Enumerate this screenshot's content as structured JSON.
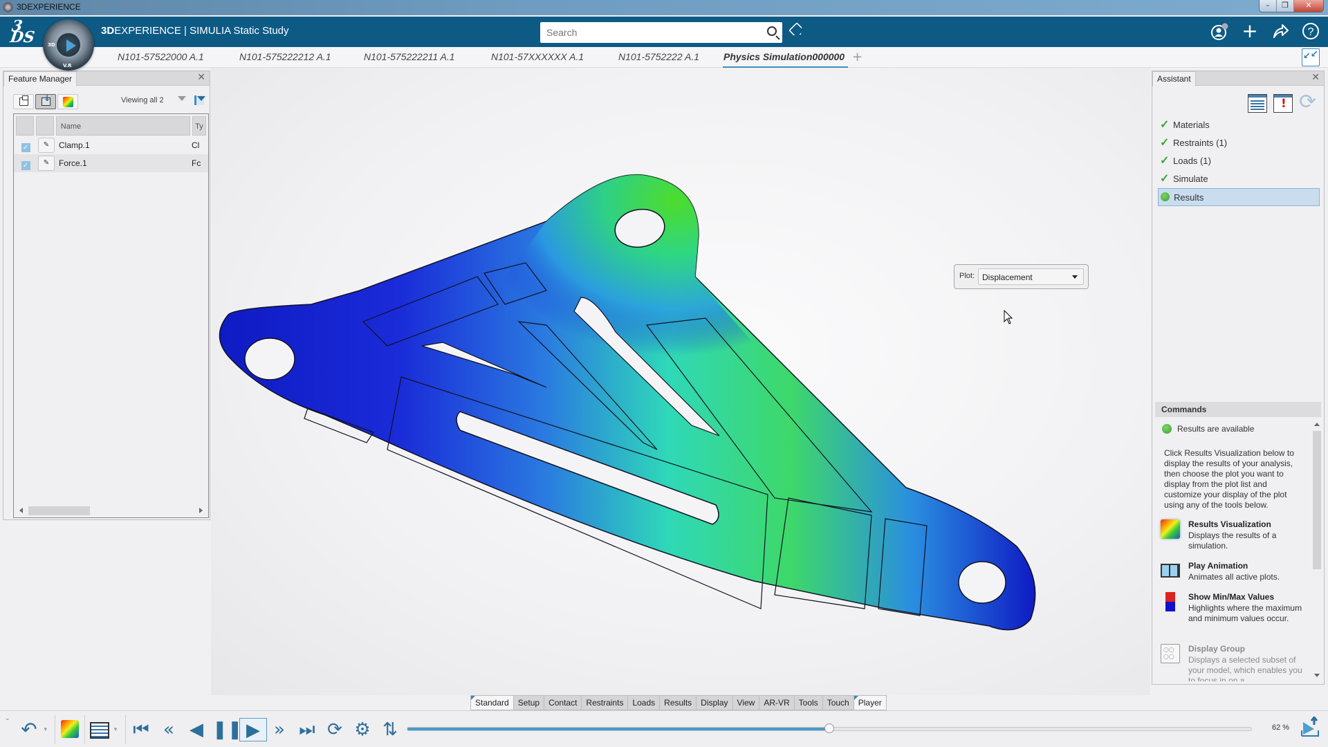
{
  "window": {
    "title": "3DEXPERIENCE",
    "controls": [
      "minimize",
      "restore",
      "close"
    ]
  },
  "header": {
    "brand_bold": "3D",
    "brand_rest": "EXPERIENCE",
    "app_name": "SIMULIA Static Study",
    "compass_labels": [
      "3D",
      "V.R"
    ],
    "search": {
      "placeholder": "Search",
      "value": ""
    },
    "icons": [
      "tag-icon",
      "user-profile-icon",
      "add-icon",
      "share-icon",
      "help-icon"
    ]
  },
  "tabs": [
    {
      "label": "N101-57522000 A.1",
      "active": false
    },
    {
      "label": "N101-575222212 A.1",
      "active": false
    },
    {
      "label": "N101-575222211 A.1",
      "active": false
    },
    {
      "label": "N101-57XXXXXX A.1",
      "active": false
    },
    {
      "label": "N101-5752222 A.1",
      "active": false
    },
    {
      "label": "Physics Simulation000000",
      "active": true
    }
  ],
  "add_tab_label": "+",
  "feature_manager": {
    "title": "Feature Manager",
    "viewing": "Viewing all 2",
    "columns": [
      "",
      "",
      "Name",
      "Ty"
    ],
    "rows": [
      {
        "checked": true,
        "name": "Clamp.1",
        "type": "Cl"
      },
      {
        "checked": true,
        "name": "Force.1",
        "type": "Fc"
      }
    ]
  },
  "viewport": {
    "plot_label": "Plot:",
    "plot_value": "Displacement",
    "model_colormap": [
      "#0a14c8",
      "#2a4fe0",
      "#2fe0b0",
      "#3cd860",
      "#47d21a"
    ]
  },
  "assistant": {
    "title": "Assistant",
    "steps": [
      {
        "label": "Materials",
        "status": "done"
      },
      {
        "label": "Restraints (1)",
        "status": "done"
      },
      {
        "label": "Loads (1)",
        "status": "done"
      },
      {
        "label": "Simulate",
        "status": "done"
      },
      {
        "label": "Results",
        "status": "active"
      }
    ],
    "commands_title": "Commands",
    "status_text": "Results are available",
    "description": "Click Results Visualization below to display the results of your analysis, then choose the plot you want to display from the plot list and customize your display of the plot using any of the tools below.",
    "commands": [
      {
        "title": "Results Visualization",
        "desc": "Displays the results of a simulation.",
        "enabled": true
      },
      {
        "title": "Play Animation",
        "desc": "Animates all active plots.",
        "enabled": true
      },
      {
        "title": "Show Min/Max Values",
        "desc": "Highlights where the maximum and minimum values occur.",
        "enabled": true
      },
      {
        "title": "Display Group",
        "desc": "Displays a selected subset of your model, which enables you to focus in on a",
        "enabled": false
      }
    ]
  },
  "bottom_tabs": [
    "Standard",
    "Setup",
    "Contact",
    "Restraints",
    "Loads",
    "Results",
    "Display",
    "View",
    "AR-VR",
    "Tools",
    "Touch",
    "Player"
  ],
  "player": {
    "progress_fraction": 0.5,
    "zoom_label": "62 %"
  }
}
